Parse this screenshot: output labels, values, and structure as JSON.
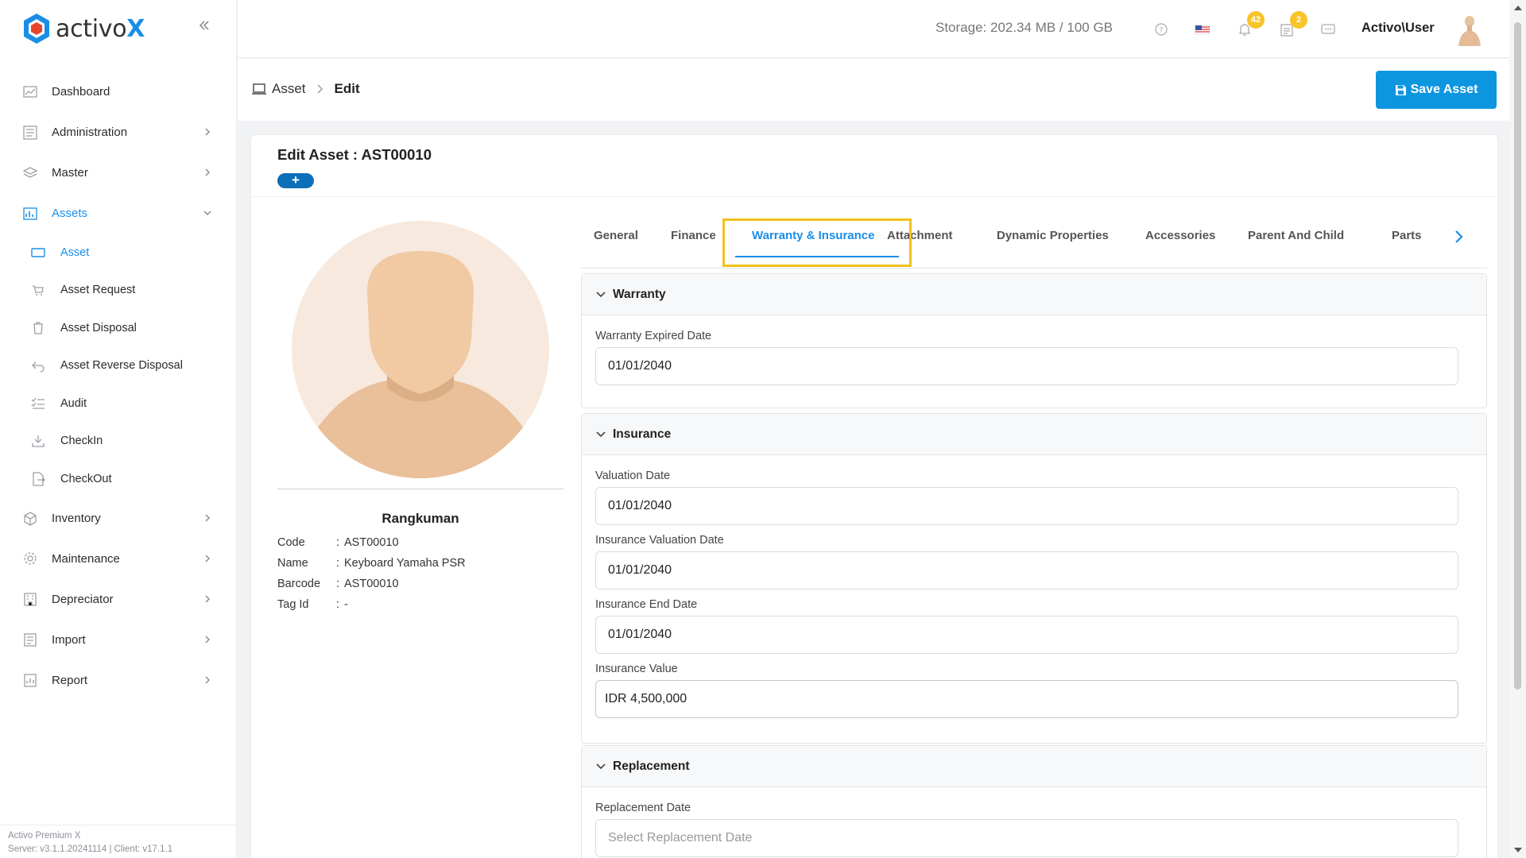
{
  "app": {
    "logo_prefix": "activo",
    "logo_suffix": "X"
  },
  "topbar": {
    "storage": "Storage: 202.34 MB / 100 GB",
    "notifications_count": "42",
    "tasks_count": "2",
    "user_name": "Activo\\User"
  },
  "sidebar": {
    "items": [
      {
        "label": "Dashboard",
        "icon": "chart-icon"
      },
      {
        "label": "Administration",
        "icon": "admin-icon"
      },
      {
        "label": "Master",
        "icon": "layers-icon"
      },
      {
        "label": "Assets",
        "icon": "assets-icon"
      },
      {
        "label": "Inventory",
        "icon": "inventory-icon"
      },
      {
        "label": "Maintenance",
        "icon": "gear-icon"
      },
      {
        "label": "Depreciator",
        "icon": "building-icon"
      },
      {
        "label": "Import",
        "icon": "import-icon"
      },
      {
        "label": "Report",
        "icon": "report-icon"
      }
    ],
    "asset_subitems": [
      {
        "label": "Asset"
      },
      {
        "label": "Asset Request"
      },
      {
        "label": "Asset Disposal"
      },
      {
        "label": "Asset Reverse Disposal"
      },
      {
        "label": "Audit"
      },
      {
        "label": "CheckIn"
      },
      {
        "label": "CheckOut"
      }
    ],
    "footer_line1": "Activo Premium X",
    "footer_line2": "Server: v3.1.1.20241114 | Client: v17.1.1"
  },
  "breadcrumb": {
    "root": "Asset",
    "current": "Edit"
  },
  "save_button": "Save Asset",
  "card": {
    "title": "Edit Asset : AST00010",
    "plus": "+",
    "profile": {
      "name": "Rangkuman",
      "rows": [
        {
          "key": "Code",
          "value": "AST00010"
        },
        {
          "key": "Name",
          "value": "Keyboard Yamaha PSR"
        },
        {
          "key": "Barcode",
          "value": "AST00010"
        },
        {
          "key": "Tag Id",
          "value": "-"
        }
      ]
    },
    "tabs": [
      "General",
      "Finance",
      "Warranty & Insurance",
      "Attachment",
      "Dynamic Properties",
      "Accessories",
      "Parent And Child",
      "Parts"
    ],
    "active_tab": "Warranty & Insurance",
    "sections": {
      "warranty": {
        "title": "Warranty",
        "fields": [
          {
            "label": "Warranty Expired Date",
            "value": "01/01/2040"
          }
        ]
      },
      "insurance": {
        "title": "Insurance",
        "fields": [
          {
            "label": "Valuation Date",
            "value": "01/01/2040"
          },
          {
            "label": "Insurance Valuation Date",
            "value": "01/01/2040"
          },
          {
            "label": "Insurance End Date",
            "value": "01/01/2040"
          },
          {
            "label": "Insurance Value",
            "value": "IDR 4,500,000"
          }
        ]
      },
      "replacement": {
        "title": "Replacement",
        "fields": [
          {
            "label": "Replacement Date",
            "placeholder": "Select Replacement Date"
          }
        ]
      }
    }
  },
  "colors": {
    "accent": "#1a8ee6",
    "save_button": "#0d96e0",
    "badge": "#f9c32a",
    "highlight": "#f2c01b"
  }
}
